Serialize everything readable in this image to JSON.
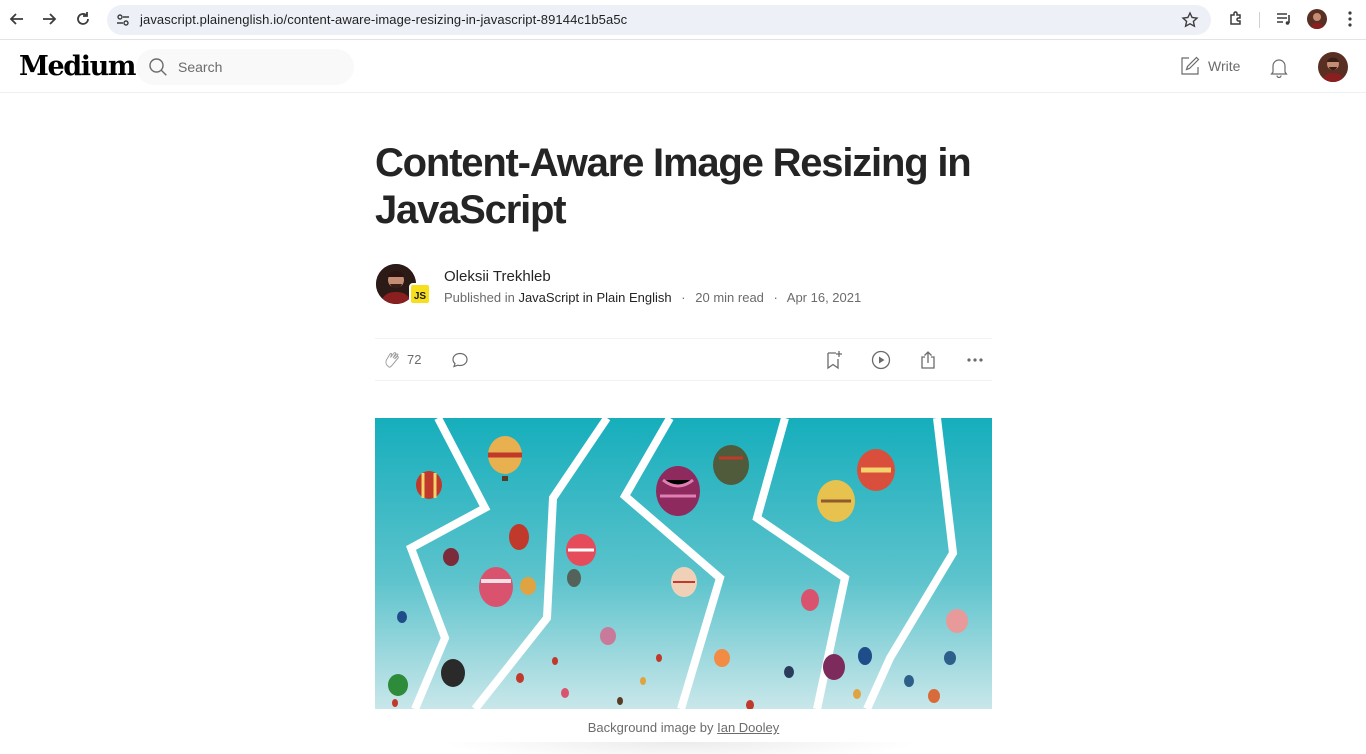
{
  "browser": {
    "url": "javascript.plainenglish.io/content-aware-image-resizing-in-javascript-89144c1b5a5c"
  },
  "header": {
    "logo": "Medium",
    "search_placeholder": "Search",
    "write_label": "Write"
  },
  "article": {
    "title": "Content-Aware Image Resizing in JavaScript",
    "author": "Oleksii Trekhleb",
    "publication_badge": "JS",
    "published_in_label": "Published in",
    "publication": "JavaScript in Plain English",
    "read_time": "20 min read",
    "date": "Apr 16, 2021",
    "clap_count": "72",
    "caption_prefix": "Background image by",
    "caption_credit": "Ian Dooley"
  },
  "colors": {
    "sky_top": "#16aebc",
    "sky_bottom": "#c9e7ea",
    "js_badge": "#f7df1e",
    "text_primary": "#242424",
    "text_secondary": "#6b6b6b"
  }
}
